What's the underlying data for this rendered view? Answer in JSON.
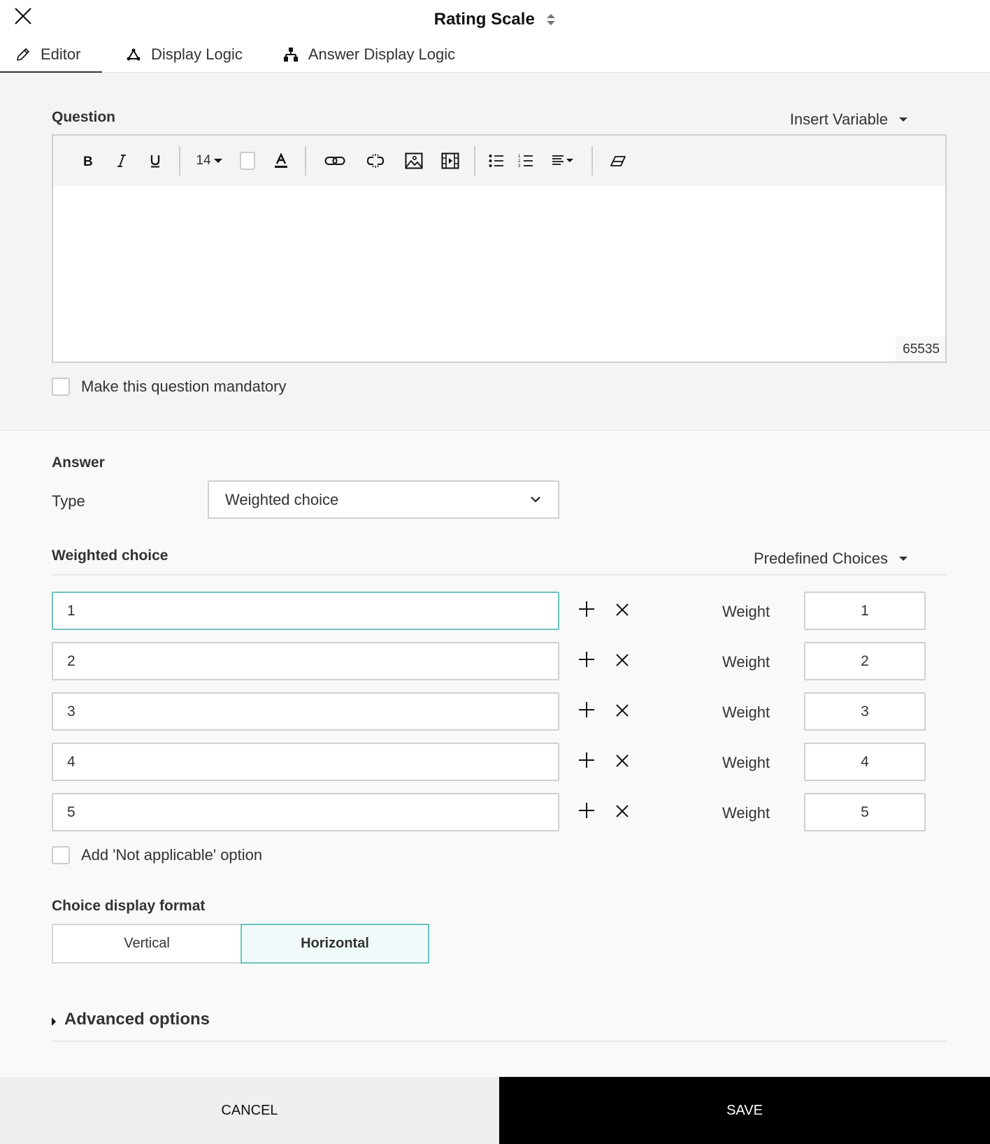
{
  "header": {
    "title": "Rating Scale",
    "tabs": [
      {
        "label": "Editor",
        "icon": "pencil-icon",
        "active": true
      },
      {
        "label": "Display Logic",
        "icon": "triangle-nodes-icon",
        "active": false
      },
      {
        "label": "Answer Display Logic",
        "icon": "hierarchy-icon",
        "active": false
      }
    ]
  },
  "question": {
    "label": "Question",
    "insert_variable": "Insert Variable",
    "toolbar": {
      "font_size": "14"
    },
    "content": "",
    "char_count": "65535",
    "mandatory_label": "Make this question mandatory",
    "mandatory_checked": false
  },
  "answer": {
    "label": "Answer",
    "type_label": "Type",
    "type_value": "Weighted choice",
    "weighted_choice_label": "Weighted choice",
    "predefined_choices": "Predefined Choices",
    "choices": [
      {
        "value": "1",
        "weight_label": "Weight",
        "weight": "1"
      },
      {
        "value": "2",
        "weight_label": "Weight",
        "weight": "2"
      },
      {
        "value": "3",
        "weight_label": "Weight",
        "weight": "3"
      },
      {
        "value": "4",
        "weight_label": "Weight",
        "weight": "4"
      },
      {
        "value": "5",
        "weight_label": "Weight",
        "weight": "5"
      }
    ],
    "not_applicable_label": "Add 'Not applicable' option",
    "not_applicable_checked": false,
    "display_format_label": "Choice display format",
    "display_format_options": [
      "Vertical",
      "Horizontal"
    ],
    "display_format_selected": "Horizontal",
    "advanced_options": "Advanced options"
  },
  "footer": {
    "cancel": "CANCEL",
    "save": "SAVE"
  },
  "colors": {
    "accent": "#6cc3c0",
    "save_bg": "#000000",
    "cancel_bg": "#efefef"
  }
}
